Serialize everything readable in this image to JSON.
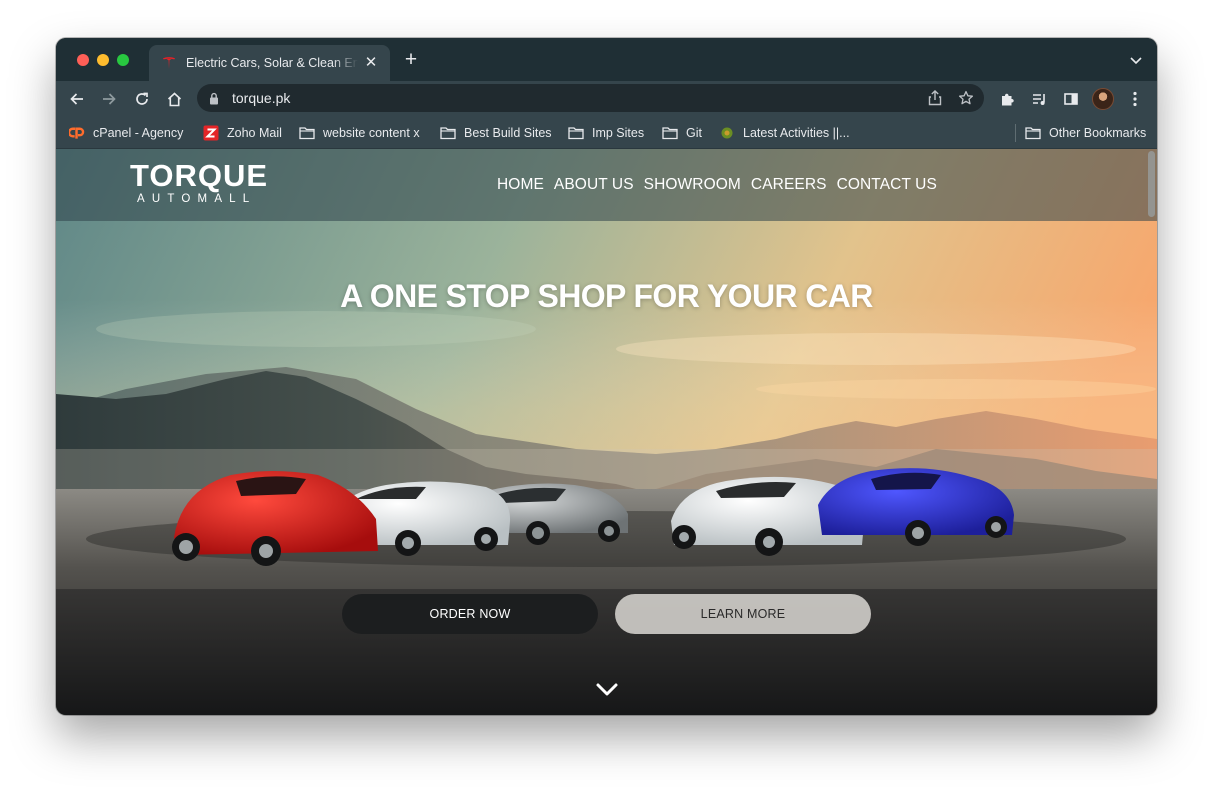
{
  "browser": {
    "tab": {
      "title": "Electric Cars, Solar & Clean Energy | Tesla",
      "favicon": "tesla-icon"
    },
    "url": "torque.pk",
    "colors": {
      "frame": "#1f2f35",
      "toolbar": "#35454c",
      "omnibox": "#202a2f"
    }
  },
  "bookmarks": [
    {
      "label": "cPanel - Agency",
      "icon": "cpanel-icon"
    },
    {
      "label": "Zoho Mail",
      "icon": "zoho-icon"
    },
    {
      "label": "website content x",
      "icon": "folder-icon"
    },
    {
      "label": "Best Build Sites",
      "icon": "folder-icon"
    },
    {
      "label": "Imp Sites",
      "icon": "folder-icon"
    },
    {
      "label": "Git",
      "icon": "folder-icon"
    },
    {
      "label": "Latest Activities ||...",
      "icon": "site-icon"
    },
    {
      "label": "Other Bookmarks",
      "icon": "folder-icon"
    }
  ],
  "site": {
    "logo": {
      "word": "TORQUE",
      "sub": "AUTOMALL"
    },
    "nav": [
      "HOME",
      "ABOUT US",
      "SHOWROOM",
      "CAREERS",
      "CONTACT US"
    ],
    "hero": {
      "title": "A ONE STOP SHOP FOR YOUR CAR",
      "primary_button": "ORDER NOW",
      "secondary_button": "LEARN MORE"
    }
  }
}
